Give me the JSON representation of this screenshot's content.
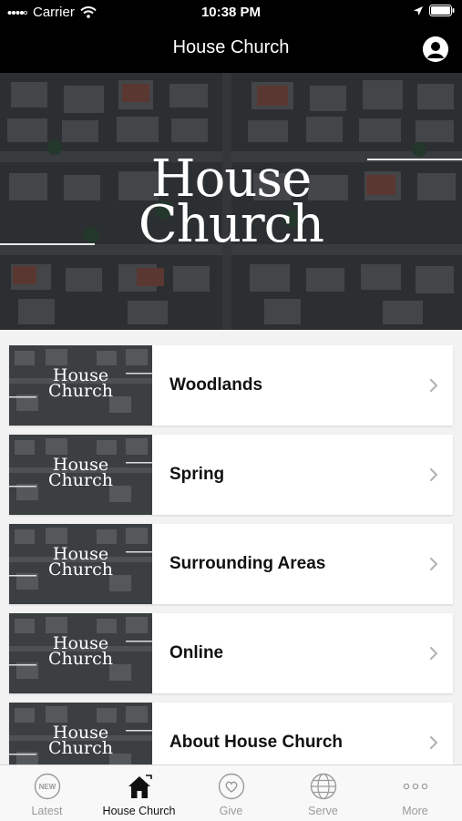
{
  "status_bar": {
    "carrier": "Carrier",
    "time": "10:38 PM"
  },
  "nav": {
    "title": "House Church"
  },
  "hero": {
    "logo_line1": "House",
    "logo_line2": "Church"
  },
  "list": {
    "items": [
      {
        "label": "Woodlands",
        "thumb_line1": "House",
        "thumb_line2": "Church"
      },
      {
        "label": "Spring",
        "thumb_line1": "House",
        "thumb_line2": "Church"
      },
      {
        "label": "Surrounding Areas",
        "thumb_line1": "House",
        "thumb_line2": "Church"
      },
      {
        "label": "Online",
        "thumb_line1": "House",
        "thumb_line2": "Church"
      },
      {
        "label": "About House Church",
        "thumb_line1": "House",
        "thumb_line2": "Church"
      }
    ]
  },
  "tab_bar": {
    "tabs": [
      {
        "label": "Latest",
        "icon": "new-badge-icon",
        "badge": "NEW"
      },
      {
        "label": "House Church",
        "icon": "house-icon"
      },
      {
        "label": "Give",
        "icon": "heart-icon"
      },
      {
        "label": "Serve",
        "icon": "globe-icon"
      },
      {
        "label": "More",
        "icon": "more-dots-icon"
      }
    ]
  },
  "colors": {
    "bar_background": "#000000",
    "active_tab": "#111111",
    "inactive_tab": "#9a9a9a"
  }
}
